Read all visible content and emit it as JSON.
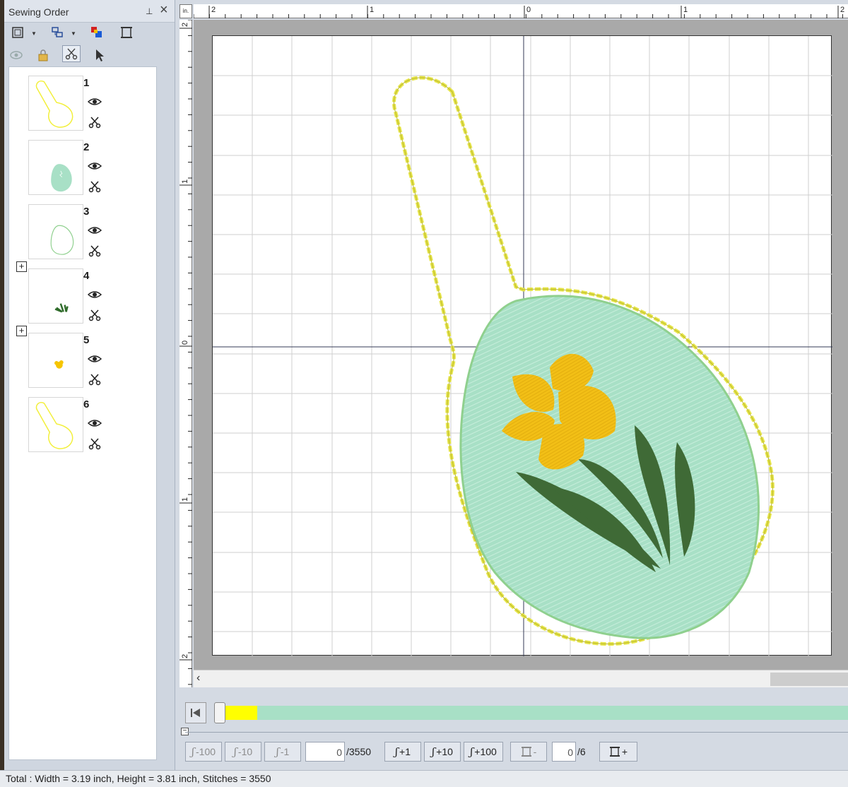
{
  "panel": {
    "title": "Sewing Order",
    "pin_icon": "pin-icon",
    "close_icon": "close-icon"
  },
  "items": [
    {
      "number": "1",
      "color": "#f2ef3a",
      "kind": "outline-tag"
    },
    {
      "number": "2",
      "color": "#a8e0c6",
      "kind": "egg-fill"
    },
    {
      "number": "3",
      "color": "#8fd08e",
      "kind": "egg-outline"
    },
    {
      "number": "4",
      "color": "#2f6b2a",
      "kind": "leaves",
      "expandable": true
    },
    {
      "number": "5",
      "color": "#f6c500",
      "kind": "flower",
      "expandable": true
    },
    {
      "number": "6",
      "color": "#f2ef3a",
      "kind": "outline-tag"
    }
  ],
  "ruler": {
    "unit": "in.",
    "top_labels": [
      "2",
      "1",
      "0",
      "1",
      "2"
    ],
    "left_labels": [
      "2",
      "1",
      "0",
      "1",
      "2"
    ]
  },
  "colors": {
    "tag_outline": "#e6e54a",
    "egg_fill": "#a8e0c6",
    "egg_edge": "#8fd08e",
    "flower": "#f2bf16",
    "leaves": "#3f6a36",
    "progress_done": "#ffff00",
    "progress_rest": "#a8e0c6"
  },
  "progress": {
    "fraction": 0.052
  },
  "controls": {
    "minus100": "-100",
    "minus10": "-10",
    "minus1": "-1",
    "stitch_value": "0",
    "stitch_total": "/3550",
    "plus1": "+1",
    "plus10": "+10",
    "plus100": "+100",
    "color_minus": "-",
    "color_value": "0",
    "color_total": "/6",
    "color_plus": "+"
  },
  "status": "Total : Width = 3.19 inch, Height = 3.81 inch, Stitches = 3550"
}
